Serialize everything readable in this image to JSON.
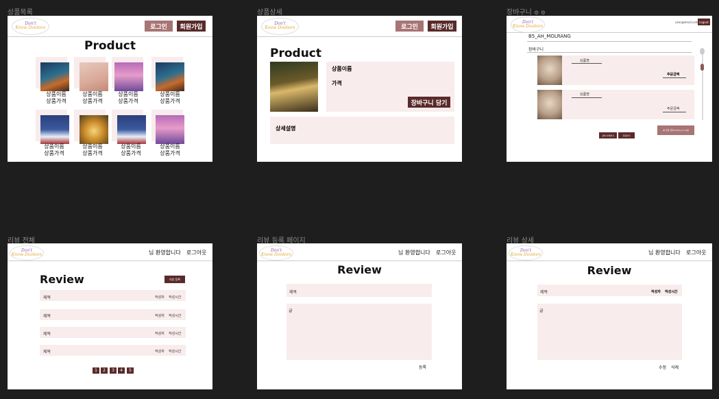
{
  "frames": {
    "product_list": {
      "label": "상품목록",
      "title": "Product",
      "login": "로그인",
      "signup": "회원가입",
      "item_name": "상품이름",
      "item_price": "상품가격"
    },
    "product_detail": {
      "label": "상품상세",
      "title": "Product",
      "login": "로그인",
      "signup": "회원가입",
      "name_label": "상품이름",
      "price_label": "가격",
      "cart_button": "장바구니 담기",
      "desc_label": "상세설명"
    },
    "cart": {
      "label": "장바구니",
      "extra_icons": "⚙ ⚙",
      "email": "user@email.com",
      "logout": "Logout",
      "username": "B5_AH_MOLRANG",
      "section": "장바구니",
      "item_name": "상품명",
      "order_amount": "주문금액",
      "total": "총 주문 금액 (total_price)원",
      "btn_select_delete": "선택 삭제하기",
      "btn_order": "주문하기"
    },
    "review_all": {
      "label": "리뷰 전체",
      "welcome": "님 환영합니다",
      "logout": "로그아웃",
      "title": "Review",
      "register_btn": "리뷰 등록",
      "rows": [
        {
          "title": "제목",
          "author": "작성자",
          "time": "작성시간"
        },
        {
          "title": "제목",
          "author": "작성자",
          "time": "작성시간"
        },
        {
          "title": "제목",
          "author": "작성자",
          "time": "작성시간"
        },
        {
          "title": "제목",
          "author": "작성자",
          "time": "작성시간"
        }
      ],
      "pages": [
        "1",
        "2",
        "3",
        "4",
        "5"
      ]
    },
    "review_write": {
      "label": "리뷰 등록 페이지",
      "welcome": "님 환영합니다",
      "logout": "로그아웃",
      "title": "Review",
      "title_field": "제목",
      "body_field": "글",
      "submit": "등록"
    },
    "review_detail": {
      "label": "리뷰 상세",
      "welcome": "님 환영합니다",
      "logout": "로그아웃",
      "title": "Review",
      "title_field": "제목",
      "author": "작성자",
      "time": "작성시간",
      "body_field": "글",
      "edit": "수정",
      "delete": "삭제"
    }
  },
  "logo": {
    "line1": "Don't",
    "line2": "Know Dooleen"
  },
  "colors": {
    "primary": "#5a2a2a",
    "rose": "#a87474",
    "pink_panel": "#f8ecec"
  }
}
